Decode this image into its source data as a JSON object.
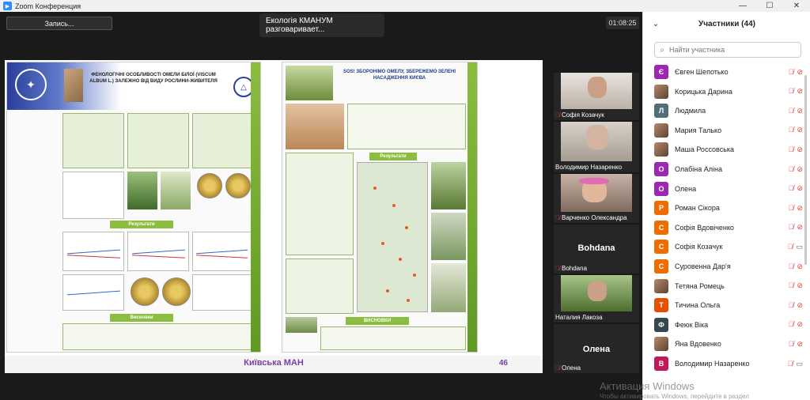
{
  "window": {
    "title": "Zoom Конференция"
  },
  "toolbar": {
    "record_label": "Запись..."
  },
  "speaker_banner": "Екологія КМАНУМ разговаривает...",
  "timer": "01:08:25",
  "slide": {
    "footer_title": "Київська МАН",
    "page_number": "46",
    "poster1_title": "ФЕНОЛОГІЧНІ ОСОБЛИВОСТІ ОМЕЛИ БІЛОЇ (VISCUM ALBUM L.) ЗАЛЕЖНО ВІД ВИДУ РОСЛИНИ-ЖИВИТЕЛЯ",
    "poster1_results": "Результати",
    "poster1_conclusions": "Висновки",
    "poster2_title": "SOS! ЗБОРОНІМО ОМЕЛУ, ЗБЕРЕЖЕМО ЗЕЛЕНІ НАСАДЖЕННЯ КИЄВА",
    "poster2_results": "Результати",
    "poster2_conclusions": "ВИСНОВКИ"
  },
  "tiles": [
    {
      "name": "Софія Козачук",
      "muted": true
    },
    {
      "name": "Володимир Назаренко",
      "muted": false
    },
    {
      "name": "Варченко Олександра",
      "muted": true
    },
    {
      "name": "Bohdana",
      "center_name": "Bohdana",
      "muted": true
    },
    {
      "name": "Наталия Лакоза",
      "muted": false
    },
    {
      "name": "Олена",
      "center_name": "Олена",
      "muted": true
    }
  ],
  "panel": {
    "title": "Участники (44)",
    "search_placeholder": "Найти участника",
    "participants": [
      {
        "name": "Євген Шепотько",
        "initial": "Є",
        "color": "#9c27b0",
        "photo": false,
        "cam_on": false
      },
      {
        "name": "Корицька Дарина",
        "initial": "",
        "color": "#7a5b44",
        "photo": true,
        "cam_on": false
      },
      {
        "name": "Людмила",
        "initial": "Л",
        "color": "#546e7a",
        "photo": false,
        "cam_on": false
      },
      {
        "name": "Мария Талько",
        "initial": "",
        "color": "#7a5b44",
        "photo": true,
        "cam_on": false
      },
      {
        "name": "Маша Россовська",
        "initial": "",
        "color": "#7a5b44",
        "photo": true,
        "cam_on": false
      },
      {
        "name": "Олабіна Аліна",
        "initial": "О",
        "color": "#9c27b0",
        "photo": false,
        "cam_on": false
      },
      {
        "name": "Олена",
        "initial": "О",
        "color": "#9c27b0",
        "photo": false,
        "cam_on": false
      },
      {
        "name": "Роман Сікора",
        "initial": "Р",
        "color": "#ef6c00",
        "photo": false,
        "cam_on": false
      },
      {
        "name": "Софія Вдовіченко",
        "initial": "С",
        "color": "#ef6c00",
        "photo": false,
        "cam_on": false
      },
      {
        "name": "Софія Козачук",
        "initial": "С",
        "color": "#ef6c00",
        "photo": false,
        "cam_on": true
      },
      {
        "name": "Суровенна Дар'я",
        "initial": "С",
        "color": "#ef6c00",
        "photo": false,
        "cam_on": false
      },
      {
        "name": "Тетяна Ромець",
        "initial": "",
        "color": "#7a5b44",
        "photo": true,
        "cam_on": false
      },
      {
        "name": "Тичина Ольга",
        "initial": "Т",
        "color": "#e65100",
        "photo": false,
        "cam_on": false
      },
      {
        "name": "Феюк Віка",
        "initial": "Ф",
        "color": "#37474f",
        "photo": false,
        "cam_on": false
      },
      {
        "name": "Яна Вдовенко",
        "initial": "",
        "color": "#7a5b44",
        "photo": true,
        "cam_on": false
      },
      {
        "name": "Володимир Назаренко",
        "initial": "В",
        "color": "#c2185b",
        "photo": false,
        "cam_on": true
      }
    ]
  },
  "watermark": {
    "title": "Активация Windows",
    "subtitle": "Чтобы активировать Windows, перейдите в раздел"
  },
  "icons": {
    "mic_off": "mic-off-icon",
    "cam_off": "camera-off-icon",
    "search": "search-icon",
    "chevron": "chevron-down-icon"
  }
}
